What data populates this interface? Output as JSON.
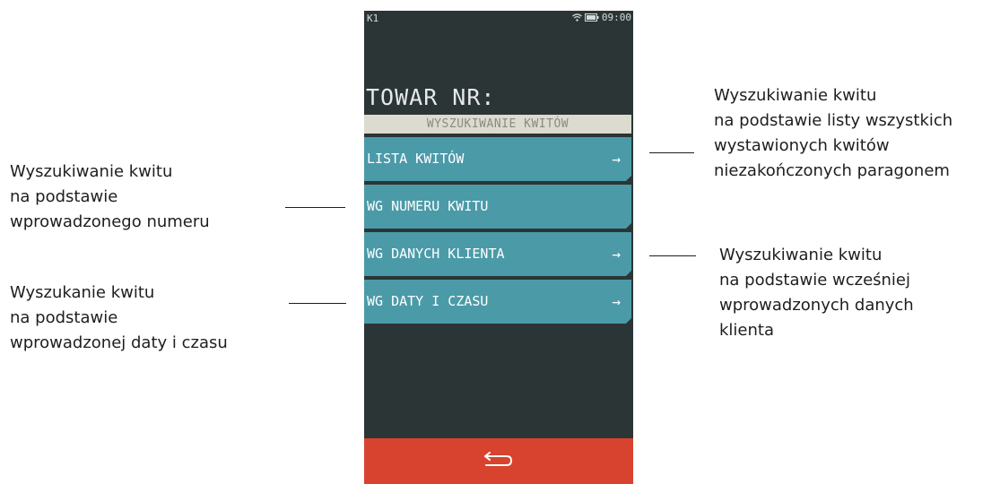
{
  "status": {
    "terminal_id": "K1",
    "time": "09:00"
  },
  "screen": {
    "title": "TOWAR NR:",
    "section_header": "WYSZUKIWANIE KWITÓW",
    "menu": [
      {
        "label": "LISTA KWITÓW",
        "arrow": "→"
      },
      {
        "label": "WG NUMERU KWITU",
        "arrow": ""
      },
      {
        "label": "WG DANYCH KLIENTA",
        "arrow": "→"
      },
      {
        "label": "WG DATY I CZASU",
        "arrow": "→"
      }
    ],
    "back_icon": "back-arrow-icon",
    "colors": {
      "background": "#2b3535",
      "menu_item": "#4b9aa8",
      "section_header": "#dcdbd0",
      "bottom_bar": "#d7432e"
    }
  },
  "annotations": {
    "lista_kwitow": [
      "Wyszukiwanie kwitu",
      "na podstawie listy wszystkich",
      "wystawionych kwitów",
      "niezakończonych paragonem"
    ],
    "numer_kwitu": [
      "Wyszukiwanie kwitu",
      "na podstawie",
      "wprowadzonego numeru"
    ],
    "dane_klienta": [
      "Wyszukiwanie kwitu",
      "na podstawie wcześniej",
      "wprowadzonych danych",
      "klienta"
    ],
    "data_czas": [
      "Wyszukanie kwitu",
      "na podstawie",
      "wprowadzonej daty i czasu"
    ]
  }
}
